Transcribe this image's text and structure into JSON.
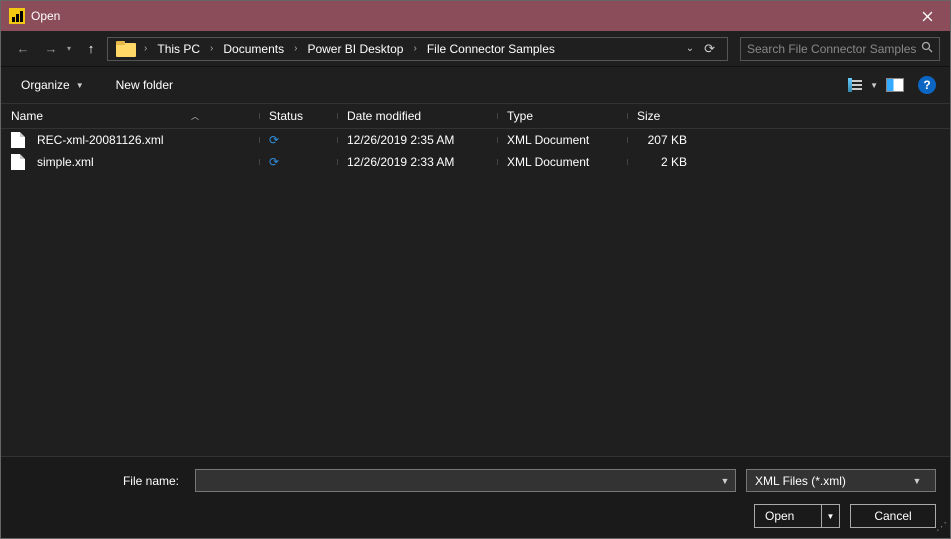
{
  "title": "Open",
  "breadcrumbs": [
    "This PC",
    "Documents",
    "Power BI Desktop",
    "File Connector Samples"
  ],
  "search": {
    "placeholder": "Search File Connector Samples"
  },
  "toolbar": {
    "organize": "Organize",
    "new_folder": "New folder"
  },
  "columns": {
    "name": "Name",
    "status": "Status",
    "date": "Date modified",
    "type": "Type",
    "size": "Size"
  },
  "files": [
    {
      "name": "REC-xml-20081126.xml",
      "date": "12/26/2019 2:35 AM",
      "type": "XML Document",
      "size": "207 KB"
    },
    {
      "name": "simple.xml",
      "date": "12/26/2019 2:33 AM",
      "type": "XML Document",
      "size": "2 KB"
    }
  ],
  "footer": {
    "filename_label": "File name:",
    "filename_value": "",
    "filter": "XML Files (*.xml)",
    "open": "Open",
    "cancel": "Cancel"
  }
}
